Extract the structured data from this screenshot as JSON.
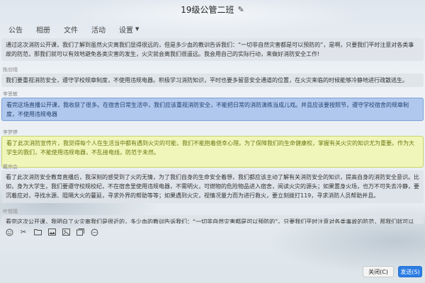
{
  "window": {
    "title": "19级公管二班",
    "edit_icon": "pencil-icon"
  },
  "tabs": [
    {
      "label": "公告"
    },
    {
      "label": "相册"
    },
    {
      "label": "文件"
    },
    {
      "label": "活动"
    },
    {
      "label": "设置",
      "dropdown": true
    }
  ],
  "messages": [
    {
      "sender": "",
      "text": "通过这次消防公开课，我们了解到虽然火灾离我们显得很远的，但是多少血的教训告诉我们：“一切非自然灾害都是可以预防的”，是啊，只要我们平时注意对各类事故的防范，那我们就可以有效地避免各类灾害的发生，火灾就会离我们很遥远。我会用自己的实际行动，来做好消防安全工作!",
      "style": "normal"
    },
    {
      "sender": "陈欣晴",
      "text": "我们要重视消防安全，遵守学校规章制度，不使用违规电器。积极学习消防知识，平时也要多留意安全通道的位置，在火灾来临的时候能够冷静地进行疏散逃生。",
      "style": "normal"
    },
    {
      "sender": "李思敏",
      "text": "看完这场直播公开课，我收获了很多。在宿舍日常生活中，我们应该重视消防安全，不能把日常的消防演练当成儿戏。并且应该要按照节，遵守学校宿舍的规章制度，不使用违规电器",
      "style": "blue"
    },
    {
      "sender": "李梦婷",
      "text": "看了此次消防宣传片，我觉得每个人在生活当中都有遇到火灾的可能，我们不能抱着侥幸心理。为了保障我们的生命健康权，掌握有关火灾的知识尤为重要。作为大学生的我们，不能使用违规电器，不乱接电线，防范于未然。",
      "style": "yellow"
    },
    {
      "sender": "戴宗会",
      "text": "看了此次消防安全教育直播后，我深刻的感受到了火的无情，为了我们自身的生命安全着想，我们都应该主动了解有关消防安全的知识，提高自身的消防安全意识。比如，身为大学生，我们要遵守校规校纪，不在宿舍里使用违规电器，不需明火，可燃物的危险物品进入宿舍，阅读火灾的源头；如果置身火场，也万不可失去冷静，要沉着应对，寻找水源、阻隔大火的蔓延，寻求外界的帮助等等；如果遇到火灾，视情况量力而为进行救火，要立刻拨打119，寻求消防人员帮助并且。",
      "style": "normal"
    },
    {
      "sender": "叶悦瑶",
      "text": "看完这次公开课，我明白了火灾离我们是很近的，多少血的教训告诉我们：“一切非自然灾害都是可以预防的”。只要我们平时注意对各类事故的防范，那我们就可以有效",
      "style": "normal"
    }
  ],
  "toolbar": [
    "emoji-icon",
    "scissors-icon",
    "folder-icon",
    "image-icon",
    "picture-icon",
    "gallery-icon",
    "more-icon"
  ],
  "buttons": {
    "close_label": "关闭(C)",
    "send_label": "发送(S)"
  }
}
